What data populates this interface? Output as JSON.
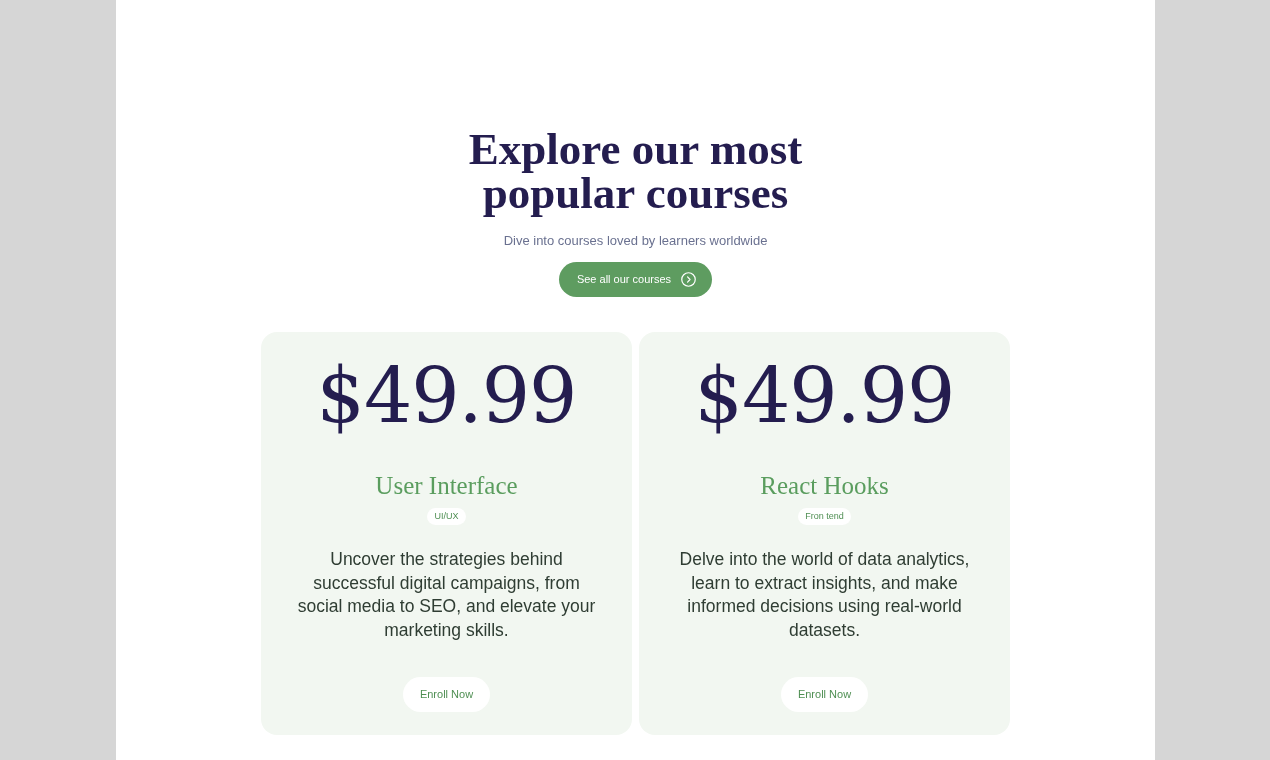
{
  "section": {
    "title": "Explore our most popular courses",
    "subtitle": "Dive into courses loved by learners worldwide",
    "cta": {
      "label": "See all our courses"
    }
  },
  "courses": [
    {
      "price": "$49.99",
      "title": "User Interface",
      "tag": "UI/UX",
      "description": "Uncover the strategies behind successful digital campaigns, from social media to SEO, and elevate your marketing skills.",
      "button": "Enroll Now"
    },
    {
      "price": "$49.99",
      "title": "React Hooks",
      "tag": "Fron tend",
      "description": "Delve into the world of data analytics, learn to extract insights, and make informed decisions using real-world datasets.",
      "button": "Enroll Now"
    }
  ]
}
